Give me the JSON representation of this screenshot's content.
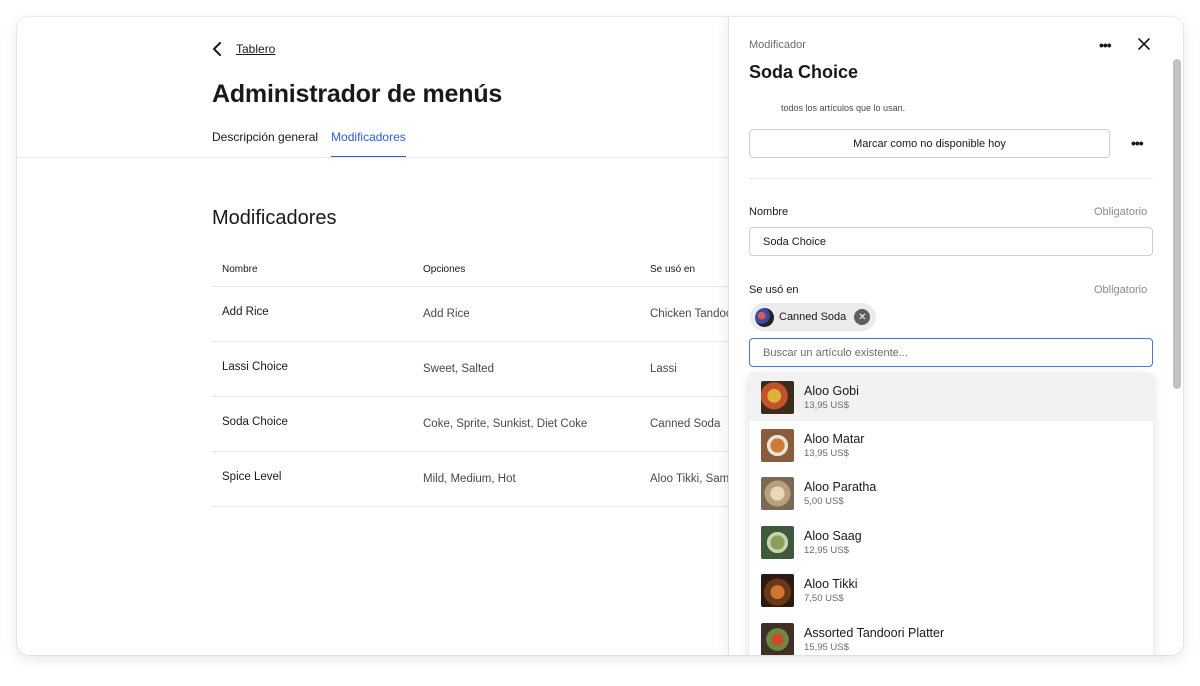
{
  "nav": {
    "back_label": "Tablero"
  },
  "page": {
    "title": "Administrador de menús",
    "tabs": [
      {
        "label": "Descripción general",
        "active": false
      },
      {
        "label": "Modificadores",
        "active": true
      }
    ],
    "accent_color": "#2f5bd3"
  },
  "modifiers_section": {
    "title": "Modificadores",
    "columns": [
      "Nombre",
      "Opciones",
      "Se usó en"
    ],
    "rows": [
      {
        "name": "Add Rice",
        "options": "Add Rice",
        "used_in": "Chicken Tandoori"
      },
      {
        "name": "Lassi Choice",
        "options": "Sweet, Salted",
        "used_in": "Lassi"
      },
      {
        "name": "Soda Choice",
        "options": "Coke, Sprite, Sunkist, Diet Coke",
        "used_in": "Canned Soda"
      },
      {
        "name": "Spice Level",
        "options": "Mild, Medium, Hot",
        "used_in": "Aloo Tikki, Samosa"
      }
    ]
  },
  "drawer": {
    "eyebrow": "Modificador",
    "title": "Soda Choice",
    "note": "todos los artículos que lo usan.",
    "unavailable_button": "Marcar como no disponible hoy",
    "name_field": {
      "label": "Nombre",
      "required": "Obligatorio",
      "value": "Soda Choice"
    },
    "used_in_field": {
      "label": "Se usó en",
      "required": "Obligatorio",
      "chips": [
        "Canned Soda"
      ],
      "search_placeholder": "Buscar un artículo existente..."
    },
    "results": [
      {
        "name": "Aloo Gobi",
        "price": "13,95 US$"
      },
      {
        "name": "Aloo Matar",
        "price": "13,95 US$"
      },
      {
        "name": "Aloo Paratha",
        "price": "5,00 US$"
      },
      {
        "name": "Aloo Saag",
        "price": "12,95 US$"
      },
      {
        "name": "Aloo Tikki",
        "price": "7,50 US$"
      },
      {
        "name": "Assorted Tandoori Platter",
        "price": "15,95 US$"
      }
    ]
  },
  "icons": [
    "chevron-left-icon",
    "more-horizontal-icon",
    "close-icon",
    "remove-chip-icon"
  ]
}
